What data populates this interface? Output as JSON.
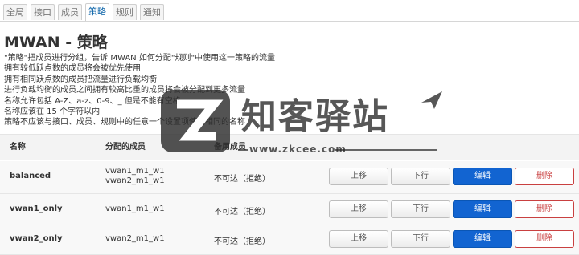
{
  "tabs": [
    {
      "label": "全局",
      "active": false
    },
    {
      "label": "接口",
      "active": false
    },
    {
      "label": "成员",
      "active": false
    },
    {
      "label": "策略",
      "active": true
    },
    {
      "label": "规则",
      "active": false
    },
    {
      "label": "通知",
      "active": false
    }
  ],
  "page": {
    "title": "MWAN - 策略",
    "description": [
      "\"策略\"把成员进行分组，告诉 MWAN 如何分配\"规则\"中使用这一策略的流量",
      "拥有较低跃点数的成员将会被优先使用",
      "拥有相同跃点数的成员把流量进行负载均衡",
      "进行负载均衡的成员之间拥有较高比重的成员将会被分配到更多流量",
      "名称允许包括 A-Z、a-z、0-9、_ 但是不能有空格",
      "名称应该在 15 个字符以内",
      "策略不应该与接口、成员、规则中的任意一个设置项使用相同的名称"
    ]
  },
  "table": {
    "headers": {
      "name": "名称",
      "members": "分配的成员",
      "backup": "备用成员"
    },
    "rows": [
      {
        "name": "balanced",
        "members": [
          "vwan1_m1_w1",
          "vwan2_m1_w1"
        ],
        "backup": "不可达（拒绝）"
      },
      {
        "name": "vwan1_only",
        "members": [
          "vwan1_m1_w1"
        ],
        "backup": "不可达（拒绝）"
      },
      {
        "name": "vwan2_only",
        "members": [
          "vwan2_m1_w1"
        ],
        "backup": "不可达（拒绝）"
      }
    ],
    "buttons": {
      "up": "上移",
      "down": "下行",
      "edit": "编辑",
      "delete": "删除"
    }
  },
  "watermark": {
    "text": "知客驿站",
    "url": "www.zkcee.com"
  },
  "colors": {
    "accent": "#1264d1",
    "danger": "#c94040",
    "active_tab": "#0b63a8"
  }
}
